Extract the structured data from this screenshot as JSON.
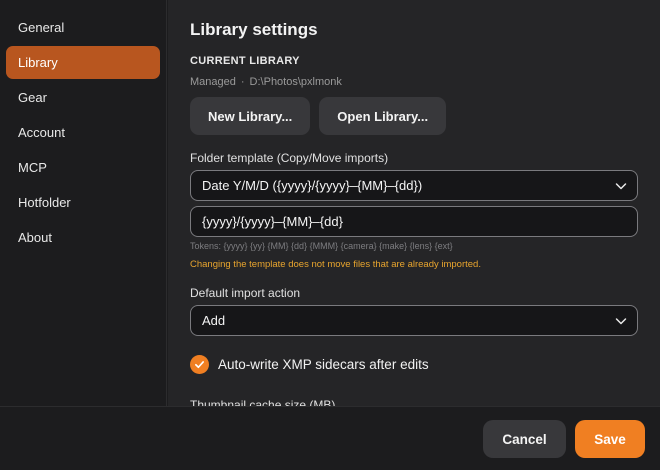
{
  "sidebar": {
    "items": [
      {
        "label": "General"
      },
      {
        "label": "Library"
      },
      {
        "label": "Gear"
      },
      {
        "label": "Account"
      },
      {
        "label": "MCP"
      },
      {
        "label": "Hotfolder"
      },
      {
        "label": "About"
      }
    ],
    "active": "Library"
  },
  "main": {
    "title": "Library settings",
    "current_library": {
      "label": "CURRENT LIBRARY",
      "mode": "Managed",
      "separator": "·",
      "path": "D:\\Photos\\pxlmonk",
      "new_button": "New Library...",
      "open_button": "Open Library..."
    },
    "folder_template": {
      "label": "Folder template (Copy/Move imports)",
      "selected": "Date Y/M/D  ({yyyy}/{yyyy}–{MM}–{dd})",
      "value": "{yyyy}/{yyyy}–{MM}–{dd}",
      "tokens": "Tokens: {yyyy} {yy} {MM} {dd} {MMM} {camera} {make} {lens} {ext}",
      "warning": "Changing the template does not move files that are already imported."
    },
    "import_action": {
      "label": "Default import action",
      "selected": "Add"
    },
    "xmp": {
      "label": "Auto-write XMP sidecars after edits",
      "checked": true
    },
    "thumbnail_cache": {
      "label": "Thumbnail cache size (MB)"
    }
  },
  "footer": {
    "cancel": "Cancel",
    "save": "Save"
  },
  "colors": {
    "accent": "#f07f22",
    "sidebar_active": "#b8561f",
    "warning": "#e8a52e"
  }
}
